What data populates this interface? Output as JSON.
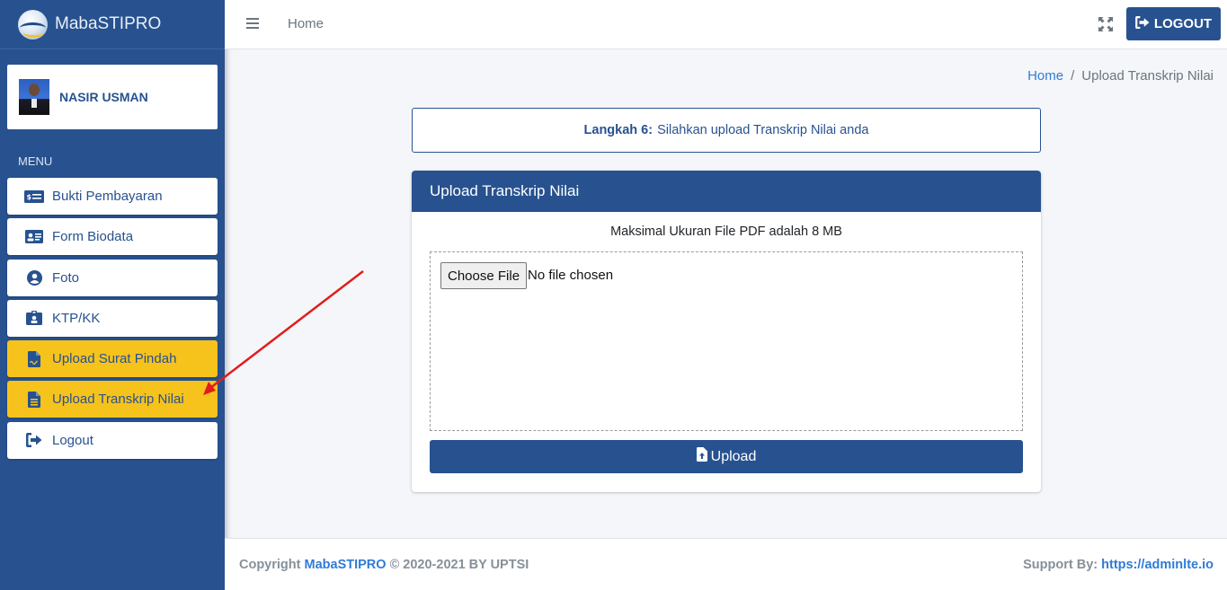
{
  "brand": {
    "name": "MabaSTIPRO"
  },
  "user": {
    "name": "NASIR USMAN"
  },
  "sidebar": {
    "menu_header": "MENU",
    "items": [
      {
        "label": "Bukti Pembayaran",
        "icon": "money-check-icon",
        "active": false
      },
      {
        "label": "Form Biodata",
        "icon": "id-card-icon",
        "active": false
      },
      {
        "label": "Foto",
        "icon": "user-circle-icon",
        "active": false
      },
      {
        "label": "KTP/KK",
        "icon": "id-badge-icon",
        "active": false
      },
      {
        "label": "Upload Surat Pindah",
        "icon": "file-signature-icon",
        "active": true
      },
      {
        "label": "Upload Transkrip Nilai",
        "icon": "file-alt-icon",
        "active": true
      },
      {
        "label": "Logout",
        "icon": "sign-out-icon",
        "active": false
      }
    ]
  },
  "topbar": {
    "home_label": "Home",
    "logout_label": "LOGOUT"
  },
  "breadcrumb": {
    "home": "Home",
    "separator": "/",
    "current": "Upload Transkrip Nilai"
  },
  "step": {
    "label": "Langkah 6:",
    "text": "Silahkan upload Transkrip Nilai anda"
  },
  "card": {
    "title": "Upload Transkrip Nilai",
    "note": "Maksimal Ukuran File PDF adalah 8 MB",
    "choose_label": "Choose File",
    "file_status": "No file chosen",
    "upload_label": "Upload"
  },
  "footer": {
    "copyright_prefix": "Copyright",
    "brand": "MabaSTIPRO",
    "copyright_suffix": "© 2020-2021 BY UPTSI",
    "support_label": "Support By:",
    "support_link": "https://adminlte.io"
  },
  "colors": {
    "primary": "#27528f",
    "active": "#f6c21c",
    "link": "#2f7bd6",
    "annotation_arrow": "#e31b1b"
  }
}
